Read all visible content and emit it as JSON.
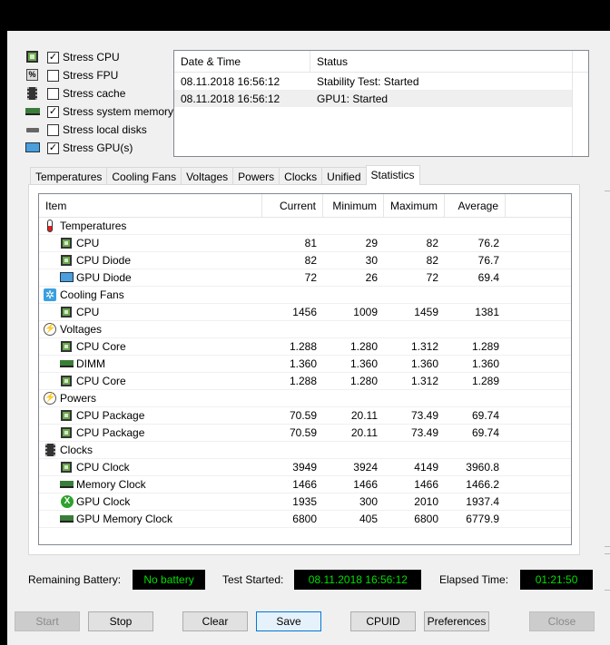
{
  "stress_options": [
    {
      "label": "Stress CPU",
      "checked": true,
      "icon": "cpu-chip-icon"
    },
    {
      "label": "Stress FPU",
      "checked": false,
      "icon": "fpu-icon"
    },
    {
      "label": "Stress cache",
      "checked": false,
      "icon": "cache-icon"
    },
    {
      "label": "Stress system memory",
      "checked": true,
      "icon": "memory-icon"
    },
    {
      "label": "Stress local disks",
      "checked": false,
      "icon": "disk-icon"
    },
    {
      "label": "Stress GPU(s)",
      "checked": true,
      "icon": "monitor-icon"
    }
  ],
  "log": {
    "headers": [
      "Date & Time",
      "Status"
    ],
    "rows": [
      {
        "time": "08.11.2018 16:56:12",
        "status": "Stability Test: Started"
      },
      {
        "time": "08.11.2018 16:56:12",
        "status": "GPU1: Started"
      }
    ]
  },
  "tabs": [
    "Temperatures",
    "Cooling Fans",
    "Voltages",
    "Powers",
    "Clocks",
    "Unified",
    "Statistics"
  ],
  "active_tab": "Statistics",
  "table": {
    "headers": [
      "Item",
      "Current",
      "Minimum",
      "Maximum",
      "Average"
    ],
    "rows": [
      {
        "type": "cat",
        "icon": "thermometer-icon",
        "name": "Temperatures"
      },
      {
        "type": "item",
        "icon": "cpu-chip-icon",
        "name": "CPU",
        "cur": "81",
        "min": "29",
        "max": "82",
        "avg": "76.2"
      },
      {
        "type": "item",
        "icon": "cpu-chip-icon",
        "name": "CPU Diode",
        "cur": "82",
        "min": "30",
        "max": "82",
        "avg": "76.7"
      },
      {
        "type": "item",
        "icon": "monitor-icon",
        "name": "GPU Diode",
        "cur": "72",
        "min": "26",
        "max": "72",
        "avg": "69.4"
      },
      {
        "type": "cat",
        "icon": "fan-icon",
        "name": "Cooling Fans"
      },
      {
        "type": "item",
        "icon": "cpu-chip-icon",
        "name": "CPU",
        "cur": "1456",
        "min": "1009",
        "max": "1459",
        "avg": "1381"
      },
      {
        "type": "cat",
        "icon": "voltage-icon",
        "name": "Voltages"
      },
      {
        "type": "item",
        "icon": "cpu-chip-icon",
        "name": "CPU Core",
        "cur": "1.288",
        "min": "1.280",
        "max": "1.312",
        "avg": "1.289"
      },
      {
        "type": "item",
        "icon": "memory-icon",
        "name": "DIMM",
        "cur": "1.360",
        "min": "1.360",
        "max": "1.360",
        "avg": "1.360"
      },
      {
        "type": "item",
        "icon": "cpu-chip-icon",
        "name": "CPU Core",
        "cur": "1.288",
        "min": "1.280",
        "max": "1.312",
        "avg": "1.289"
      },
      {
        "type": "cat",
        "icon": "voltage-icon",
        "name": "Powers"
      },
      {
        "type": "item",
        "icon": "cpu-chip-icon",
        "name": "CPU Package",
        "cur": "70.59",
        "min": "20.11",
        "max": "73.49",
        "avg": "69.74"
      },
      {
        "type": "item",
        "icon": "cpu-chip-icon",
        "name": "CPU Package",
        "cur": "70.59",
        "min": "20.11",
        "max": "73.49",
        "avg": "69.74"
      },
      {
        "type": "cat",
        "icon": "clock-icon",
        "name": "Clocks"
      },
      {
        "type": "item",
        "icon": "cpu-chip-icon",
        "name": "CPU Clock",
        "cur": "3949",
        "min": "3924",
        "max": "4149",
        "avg": "3960.8"
      },
      {
        "type": "item",
        "icon": "memory-icon",
        "name": "Memory Clock",
        "cur": "1466",
        "min": "1466",
        "max": "1466",
        "avg": "1466.2"
      },
      {
        "type": "item",
        "icon": "xbox-icon",
        "name": "GPU Clock",
        "cur": "1935",
        "min": "300",
        "max": "2010",
        "avg": "1937.4"
      },
      {
        "type": "item",
        "icon": "memory-icon",
        "name": "GPU Memory Clock",
        "cur": "6800",
        "min": "405",
        "max": "6800",
        "avg": "6779.9"
      }
    ]
  },
  "status": {
    "battery_label": "Remaining Battery:",
    "battery_value": "No battery",
    "started_label": "Test Started:",
    "started_value": "08.11.2018 16:56:12",
    "elapsed_label": "Elapsed Time:",
    "elapsed_value": "01:21:50"
  },
  "buttons": {
    "start": "Start",
    "stop": "Stop",
    "clear": "Clear",
    "save": "Save",
    "cpuid": "CPUID",
    "preferences": "Preferences",
    "close": "Close"
  }
}
